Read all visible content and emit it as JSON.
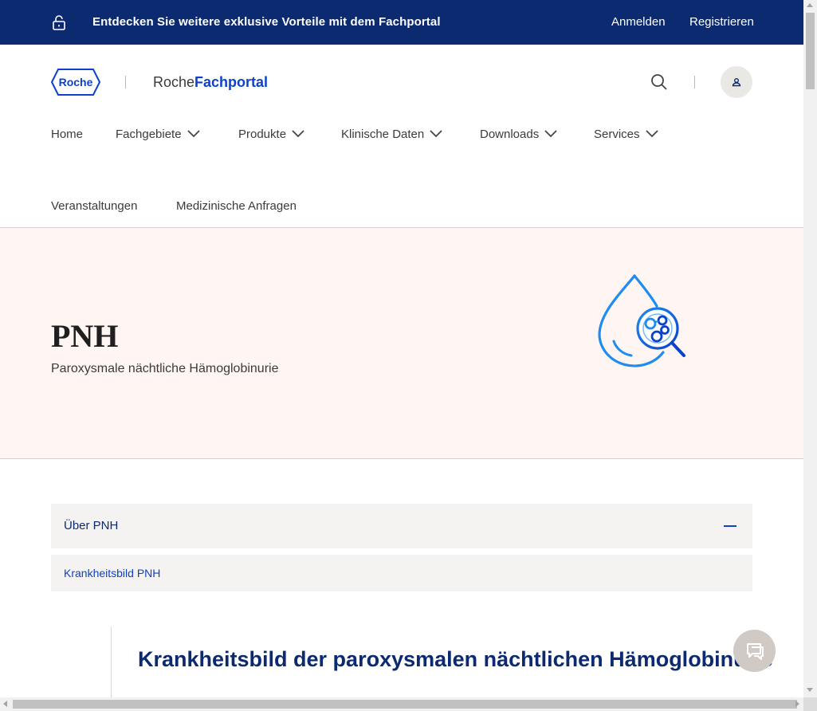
{
  "banner": {
    "promo_text": "Entdecken Sie weitere exklusive Vorteile mit dem Fachportal",
    "login_label": "Anmelden",
    "register_label": "Registrieren",
    "lock_icon": "unlock-icon"
  },
  "header": {
    "logo_text": "Roche",
    "portal_prefix": "Roche",
    "portal_brand": "Fachportal",
    "search_icon": "search-icon",
    "user_icon": "user-icon"
  },
  "nav": {
    "row1": [
      {
        "label": "Home",
        "has_dropdown": false
      },
      {
        "label": "Fachgebiete",
        "has_dropdown": true
      },
      {
        "label": "Produkte",
        "has_dropdown": true
      },
      {
        "label": "Klinische Daten",
        "has_dropdown": true
      },
      {
        "label": "Downloads",
        "has_dropdown": true
      },
      {
        "label": "Services",
        "has_dropdown": true
      }
    ],
    "row2": [
      {
        "label": "Veranstaltungen"
      },
      {
        "label": "Medizinische Anfragen"
      }
    ]
  },
  "hero": {
    "title": "PNH",
    "subtitle": "Paroxysmale nächtliche Hämoglobinurie",
    "icon": "blood-drop-magnifier-icon"
  },
  "accordion": {
    "header_label": "Über PNH",
    "expanded": true,
    "link_label": "Krankheitsbild PNH"
  },
  "content": {
    "heading": "Krankheitsbild der paroxysmalen nächtlichen Hämoglobinurie"
  },
  "chat": {
    "icon": "chat-icon"
  },
  "colors": {
    "banner_bg": "#0b2a6f",
    "brand_blue": "#0b41cd",
    "hero_bg": "#fff5f3",
    "hero_border": "#f0c6bf",
    "accordion_bg": "#f4f3f1"
  }
}
